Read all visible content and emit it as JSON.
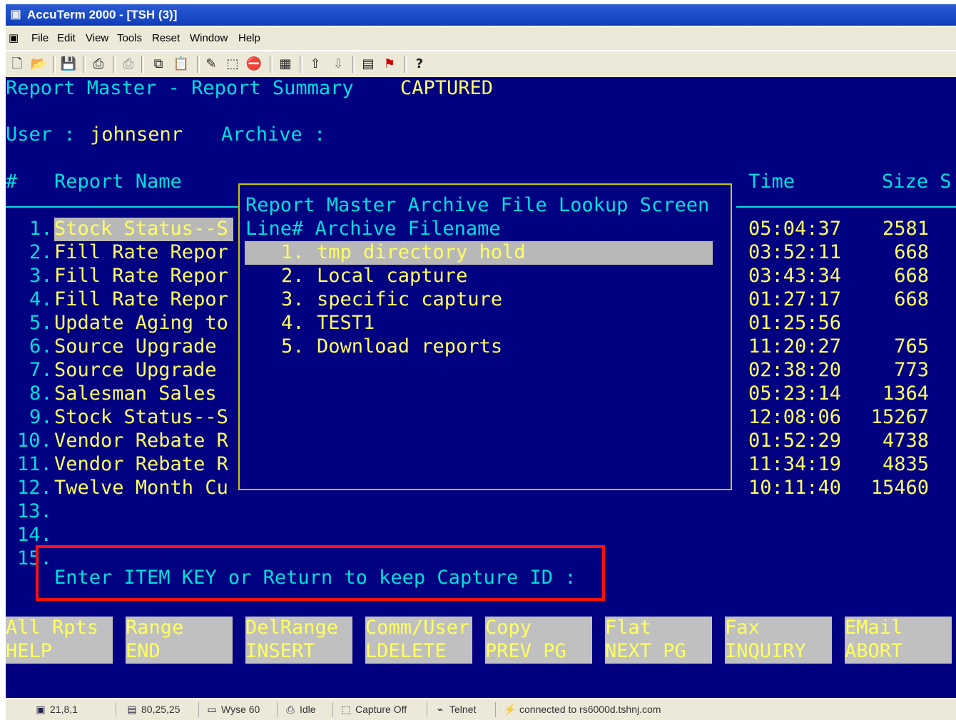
{
  "window": {
    "title": "AccuTerm 2000 - [TSH (3)]",
    "app_icon": "terminal-app-icon"
  },
  "menu": {
    "items": [
      "File",
      "Edit",
      "View",
      "Tools",
      "Reset",
      "Window",
      "Help"
    ]
  },
  "toolbar": {
    "icons": [
      "new-icon",
      "open-icon",
      "save-icon",
      "print-icon",
      "print-disabled-icon",
      "copy-icon",
      "paste-icon",
      "capture-icon",
      "select-icon",
      "stop-icon",
      "macro-icon",
      "upload-icon",
      "download-icon",
      "message-icon",
      "script-icon",
      "help-icon"
    ]
  },
  "screen": {
    "title": "Report Master - Report Summary",
    "status": "CAPTURED",
    "user_label": "User :",
    "user_value": "johnsenr",
    "archive_label": "Archive :",
    "headers": {
      "num": "#",
      "name": "Report Name",
      "time": "Time",
      "size": "Size S"
    },
    "rows": [
      {
        "num": "1.",
        "name": "Stock Status--S",
        "time": "05:04:37",
        "size": "2581"
      },
      {
        "num": "2.",
        "name": "Fill Rate Repor",
        "time": "03:52:11",
        "size": "668"
      },
      {
        "num": "3.",
        "name": "Fill Rate Repor",
        "time": "03:43:34",
        "size": "668"
      },
      {
        "num": "4.",
        "name": "Fill Rate Repor",
        "time": "01:27:17",
        "size": "668"
      },
      {
        "num": "5.",
        "name": "Update Aging to",
        "time": "01:25:56",
        "size": ""
      },
      {
        "num": "6.",
        "name": "Source Upgrade",
        "time": "11:20:27",
        "size": "765"
      },
      {
        "num": "7.",
        "name": "Source Upgrade",
        "time": "02:38:20",
        "size": "773"
      },
      {
        "num": "8.",
        "name": "Salesman Sales",
        "time": "05:23:14",
        "size": "1364"
      },
      {
        "num": "9.",
        "name": "Stock Status--S",
        "time": "12:08:06",
        "size": "15267"
      },
      {
        "num": "10.",
        "name": "Vendor Rebate R",
        "time": "01:52:29",
        "size": "4738"
      },
      {
        "num": "11.",
        "name": "Vendor Rebate R",
        "time": "11:34:19",
        "size": "4835"
      },
      {
        "num": "12.",
        "name": "Twelve Month Cu",
        "time": "10:11:40",
        "size": "15460"
      },
      {
        "num": "13.",
        "name": "",
        "time": "",
        "size": ""
      },
      {
        "num": "14.",
        "name": "",
        "time": "",
        "size": ""
      },
      {
        "num": "15.",
        "name": "",
        "time": "",
        "size": ""
      }
    ],
    "prompt": "Enter ITEM KEY or Return to keep Capture ID :"
  },
  "popup": {
    "title": "Report Master Archive File Lookup Screen",
    "header": "Line# Archive Filename",
    "items": [
      {
        "num": "1.",
        "name": "tmp directory hold"
      },
      {
        "num": "2.",
        "name": "Local capture"
      },
      {
        "num": "3.",
        "name": "specific capture"
      },
      {
        "num": "4.",
        "name": "TEST1"
      },
      {
        "num": "5.",
        "name": "Download reports"
      }
    ]
  },
  "function_keys": [
    {
      "line1": "All Rpts",
      "line2": "HELP"
    },
    {
      "line1": "Range",
      "line2": "END"
    },
    {
      "line1": "DelRange",
      "line2": "INSERT"
    },
    {
      "line1": "Comm/User",
      "line2": "LDELETE"
    },
    {
      "line1": "Copy",
      "line2": "PREV PG"
    },
    {
      "line1": "Flat",
      "line2": "NEXT PG"
    },
    {
      "line1": "Fax",
      "line2": "INQUIRY"
    },
    {
      "line1": "EMail",
      "line2": "ABORT"
    }
  ],
  "statusbar": {
    "cursor": "21,8,1",
    "size": "80,25,25",
    "emulation": "Wyse 60",
    "state": "Idle",
    "capture": "Capture Off",
    "protocol": "Telnet",
    "connection": "connected to rs6000d.tshnj.com"
  },
  "colors": {
    "terminal_bg": "#000080",
    "cyan_text": "#00dede",
    "yellow_text": "#ffff60",
    "highlight": "#b8b8b8",
    "annotation": "#ff1010"
  }
}
